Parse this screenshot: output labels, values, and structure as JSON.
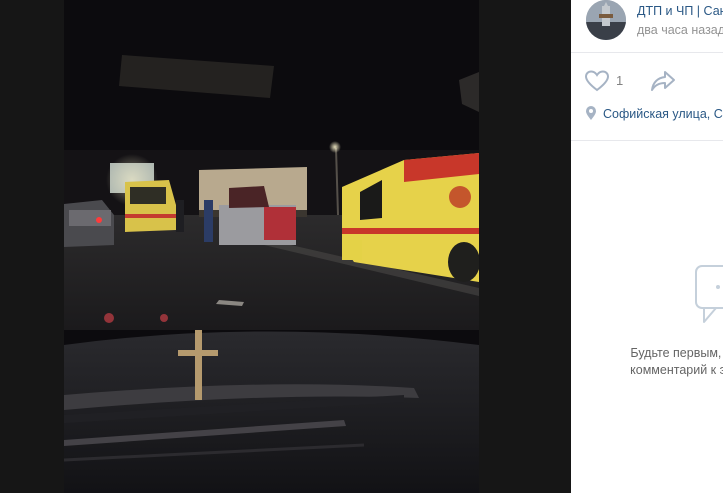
{
  "post": {
    "author": "ДТП и ЧП | Санкт-Петербург",
    "time": "два часа назад",
    "likes": "1",
    "location": "Софийская улица, Санкт-Петербург"
  },
  "comments": {
    "empty_line1": "Будьте первым, кто оставит",
    "empty_line2": "комментарий к этой записи."
  },
  "icons": {
    "like": "heart-icon",
    "share": "share-arrow-icon",
    "location": "location-pin-icon",
    "comments": "comment-bubble-icon"
  },
  "colors": {
    "link": "#2a5885",
    "muted": "#939393",
    "icon": "#a6b3c4"
  }
}
